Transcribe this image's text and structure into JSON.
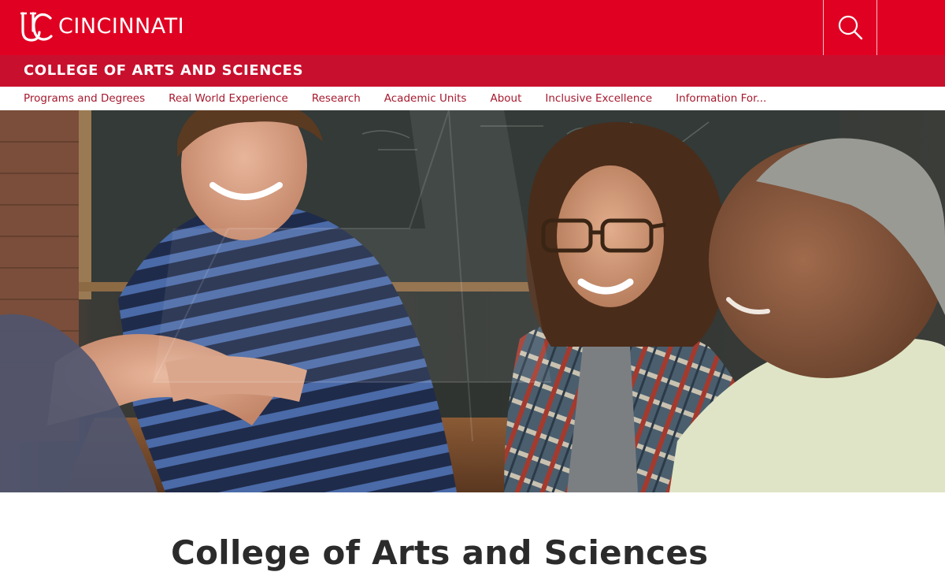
{
  "header": {
    "logo_text": "CINCINNATI",
    "logo_mark_text": "UC",
    "search_icon": "search-icon",
    "brand_color": "#e00122"
  },
  "college_bar": {
    "name": "COLLEGE OF ARTS AND SCIENCES",
    "color": "#c8102e"
  },
  "nav": {
    "items": [
      "Programs and Degrees",
      "Real World Experience",
      "Research",
      "Academic Units",
      "About",
      "Inclusive Excellence",
      "Information For..."
    ],
    "link_color": "#a6192e"
  },
  "main": {
    "title": "College of Arts and Sciences"
  }
}
